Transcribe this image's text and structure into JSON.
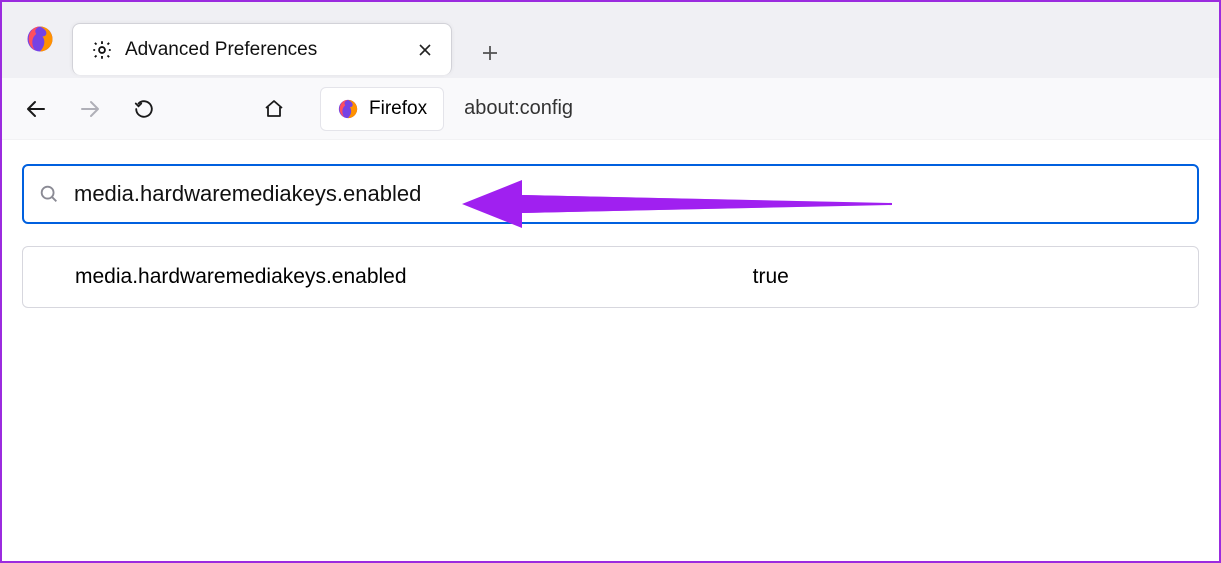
{
  "window": {
    "tab_title": "Advanced Preferences"
  },
  "addressbar": {
    "identity_label": "Firefox",
    "url": "about:config"
  },
  "search": {
    "value": "media.hardwaremediakeys.enabled"
  },
  "results": [
    {
      "name": "media.hardwaremediakeys.enabled",
      "value": "true"
    }
  ],
  "annotation": {
    "arrow_color": "#a020f0"
  }
}
